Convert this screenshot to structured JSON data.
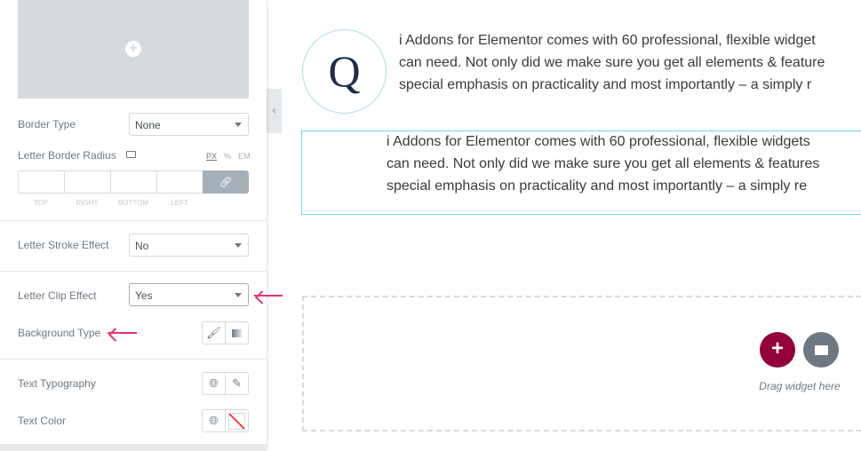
{
  "panel": {
    "border_type": {
      "label": "Border Type",
      "value": "None"
    },
    "letter_border_radius": {
      "label": "Letter Border Radius",
      "units": [
        "PX",
        "%",
        "EM"
      ],
      "sides": [
        "TOP",
        "RIGHT",
        "BOTTOM",
        "LEFT"
      ]
    },
    "letter_stroke_effect": {
      "label": "Letter Stroke Effect",
      "value": "No"
    },
    "letter_clip_effect": {
      "label": "Letter Clip Effect",
      "value": "Yes"
    },
    "background_type": {
      "label": "Background Type"
    },
    "text_typography": {
      "label": "Text Typography"
    },
    "text_color": {
      "label": "Text Color"
    }
  },
  "canvas": {
    "dropcap_letter": "Q",
    "para1": [
      "i Addons for Elementor comes with 60 professional, flexible widget",
      "can need. Not only did we make sure you get all elements & feature",
      "special emphasis on practicality and most importantly – a simply r"
    ],
    "para2": [
      "i Addons for Elementor comes with 60 professional, flexible widgets",
      "can need. Not only did we make sure you get all elements & features",
      "special emphasis on practicality and most importantly – a simply re"
    ],
    "drop_hint": "Drag widget here"
  },
  "colors": {
    "accent": "#93003c",
    "arrow": "#e8336a",
    "selection": "#71d7f7",
    "letter": "#1c2e4a"
  }
}
